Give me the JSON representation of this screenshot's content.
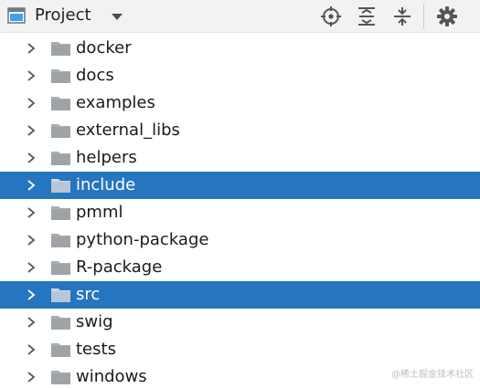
{
  "header": {
    "title": "Project",
    "dropdown_icon": "caret-down-icon",
    "tools": [
      {
        "name": "locate-icon"
      },
      {
        "name": "expand-all-icon"
      },
      {
        "name": "collapse-all-icon"
      },
      {
        "name": "gear-icon"
      }
    ]
  },
  "colors": {
    "selection": "#2675bf",
    "folder": "#a9aeb3",
    "header_bg": "#f2f2f2"
  },
  "tree": {
    "items": [
      {
        "label": "docker",
        "selected": false
      },
      {
        "label": "docs",
        "selected": false
      },
      {
        "label": "examples",
        "selected": false
      },
      {
        "label": "external_libs",
        "selected": false
      },
      {
        "label": "helpers",
        "selected": false
      },
      {
        "label": "include",
        "selected": true
      },
      {
        "label": "pmml",
        "selected": false
      },
      {
        "label": "python-package",
        "selected": false
      },
      {
        "label": "R-package",
        "selected": false
      },
      {
        "label": "src",
        "selected": true
      },
      {
        "label": "swig",
        "selected": false
      },
      {
        "label": "tests",
        "selected": false
      },
      {
        "label": "windows",
        "selected": false
      }
    ]
  },
  "watermark": "@稀土掘金技术社区"
}
